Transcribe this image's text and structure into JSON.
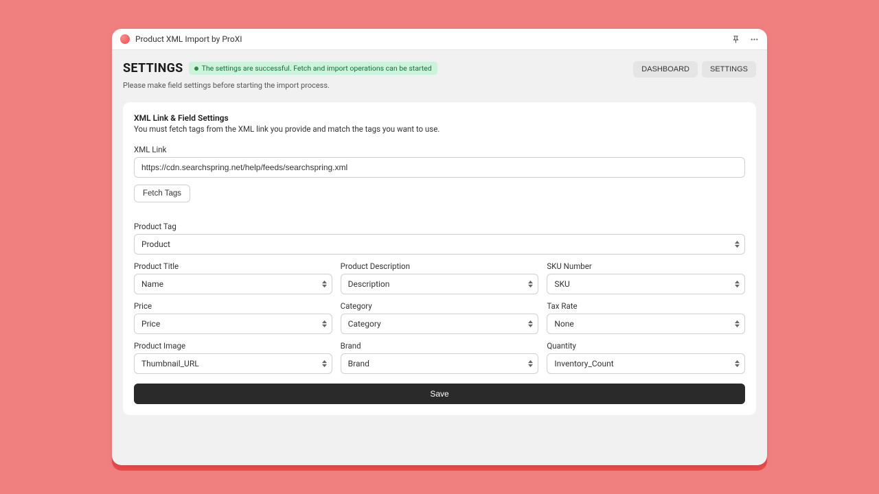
{
  "app": {
    "title": "Product XML Import by ProXI"
  },
  "header": {
    "title": "SETTINGS",
    "status": "The settings are successful. Fetch and import operations can be started",
    "subtitle": "Please make field settings before starting the import process.",
    "nav": {
      "dashboard": "DASHBOARD",
      "settings": "SETTINGS"
    }
  },
  "card": {
    "title": "XML Link & Field Settings",
    "description": "You must fetch tags from the XML link you provide and match the tags you want to use.",
    "xml_link_label": "XML Link",
    "xml_link_value": "https://cdn.searchspring.net/help/feeds/searchspring.xml",
    "fetch_button": "Fetch Tags",
    "product_tag": {
      "label": "Product Tag",
      "value": "Product"
    },
    "fields": {
      "title": {
        "label": "Product Title",
        "value": "Name"
      },
      "description": {
        "label": "Product Description",
        "value": "Description"
      },
      "sku": {
        "label": "SKU Number",
        "value": "SKU"
      },
      "price": {
        "label": "Price",
        "value": "Price"
      },
      "category": {
        "label": "Category",
        "value": "Category"
      },
      "tax": {
        "label": "Tax Rate",
        "value": "None"
      },
      "image": {
        "label": "Product Image",
        "value": "Thumbnail_URL"
      },
      "brand": {
        "label": "Brand",
        "value": "Brand"
      },
      "quantity": {
        "label": "Quantity",
        "value": "Inventory_Count"
      }
    },
    "save_button": "Save"
  }
}
